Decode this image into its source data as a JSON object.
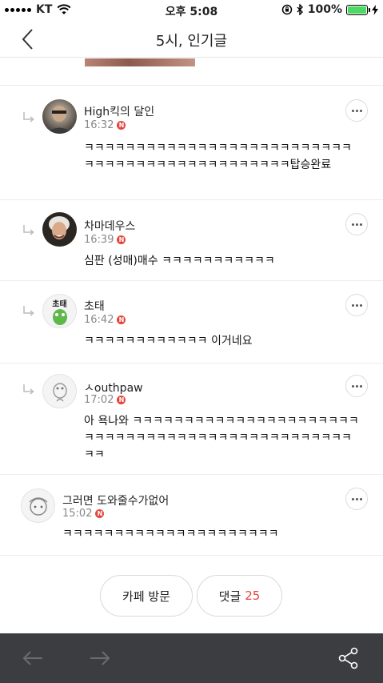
{
  "status_bar": {
    "carrier": "KT",
    "time": "오후 5:08",
    "battery": "100%",
    "battery_level": 1.0
  },
  "header": {
    "title": "5시, 인기글",
    "back_icon": "chevron-left-icon"
  },
  "comments": [
    {
      "author": "High킥의 달인",
      "time": "16:32",
      "badge": "N",
      "text": "ㅋㅋㅋㅋㅋㅋㅋㅋㅋㅋㅋㅋㅋㅋㅋㅋㅋㅋㅋㅋㅋㅋㅋㅋㅋㅋㅋㅋㅋㅋㅋㅋㅋㅋㅋㅋㅋㅋㅋㅋㅋㅋㅋㅋㅋㅋ탑승완료",
      "is_reply": true
    },
    {
      "author": "차마데우스",
      "time": "16:39",
      "badge": "N",
      "text": "심판 (성매)매수 ㅋㅋㅋㅋㅋㅋㅋㅋㅋㅋㅋ",
      "is_reply": true
    },
    {
      "author": "초태",
      "time": "16:42",
      "badge": "N",
      "avatar_text": "초태",
      "text": "ㅋㅋㅋㅋㅋㅋㅋㅋㅋㅋㅋㅋ 이거네요",
      "is_reply": true
    },
    {
      "author": "ㅅouthpaw",
      "time": "17:02",
      "badge": "N",
      "text": "아 욕나와 ㅋㅋㅋㅋㅋㅋㅋㅋㅋㅋㅋㅋㅋㅋㅋㅋㅋㅋㅋㅋㅋㅋㅋㅋㅋㅋㅋㅋㅋㅋㅋㅋㅋㅋㅋㅋㅋㅋㅋㅋㅋㅋㅋㅋㅋㅋㅋㅋㅋㅋ",
      "is_reply": true
    },
    {
      "author": "그러면 도와줄수가없어",
      "time": "15:02",
      "badge": "N",
      "text": "ㅋㅋㅋㅋㅋㅋㅋㅋㅋㅋㅋㅋㅋㅋㅋㅋㅋㅋㅋㅋㅋ",
      "is_reply": false
    }
  ],
  "actions": {
    "visit_cafe": "카페 방문",
    "comments_label": "댓글",
    "comments_count": "25"
  },
  "colors": {
    "accent": "#e4463d",
    "bottom_bar": "#3c3d40",
    "battery_fill": "#4cd964"
  }
}
